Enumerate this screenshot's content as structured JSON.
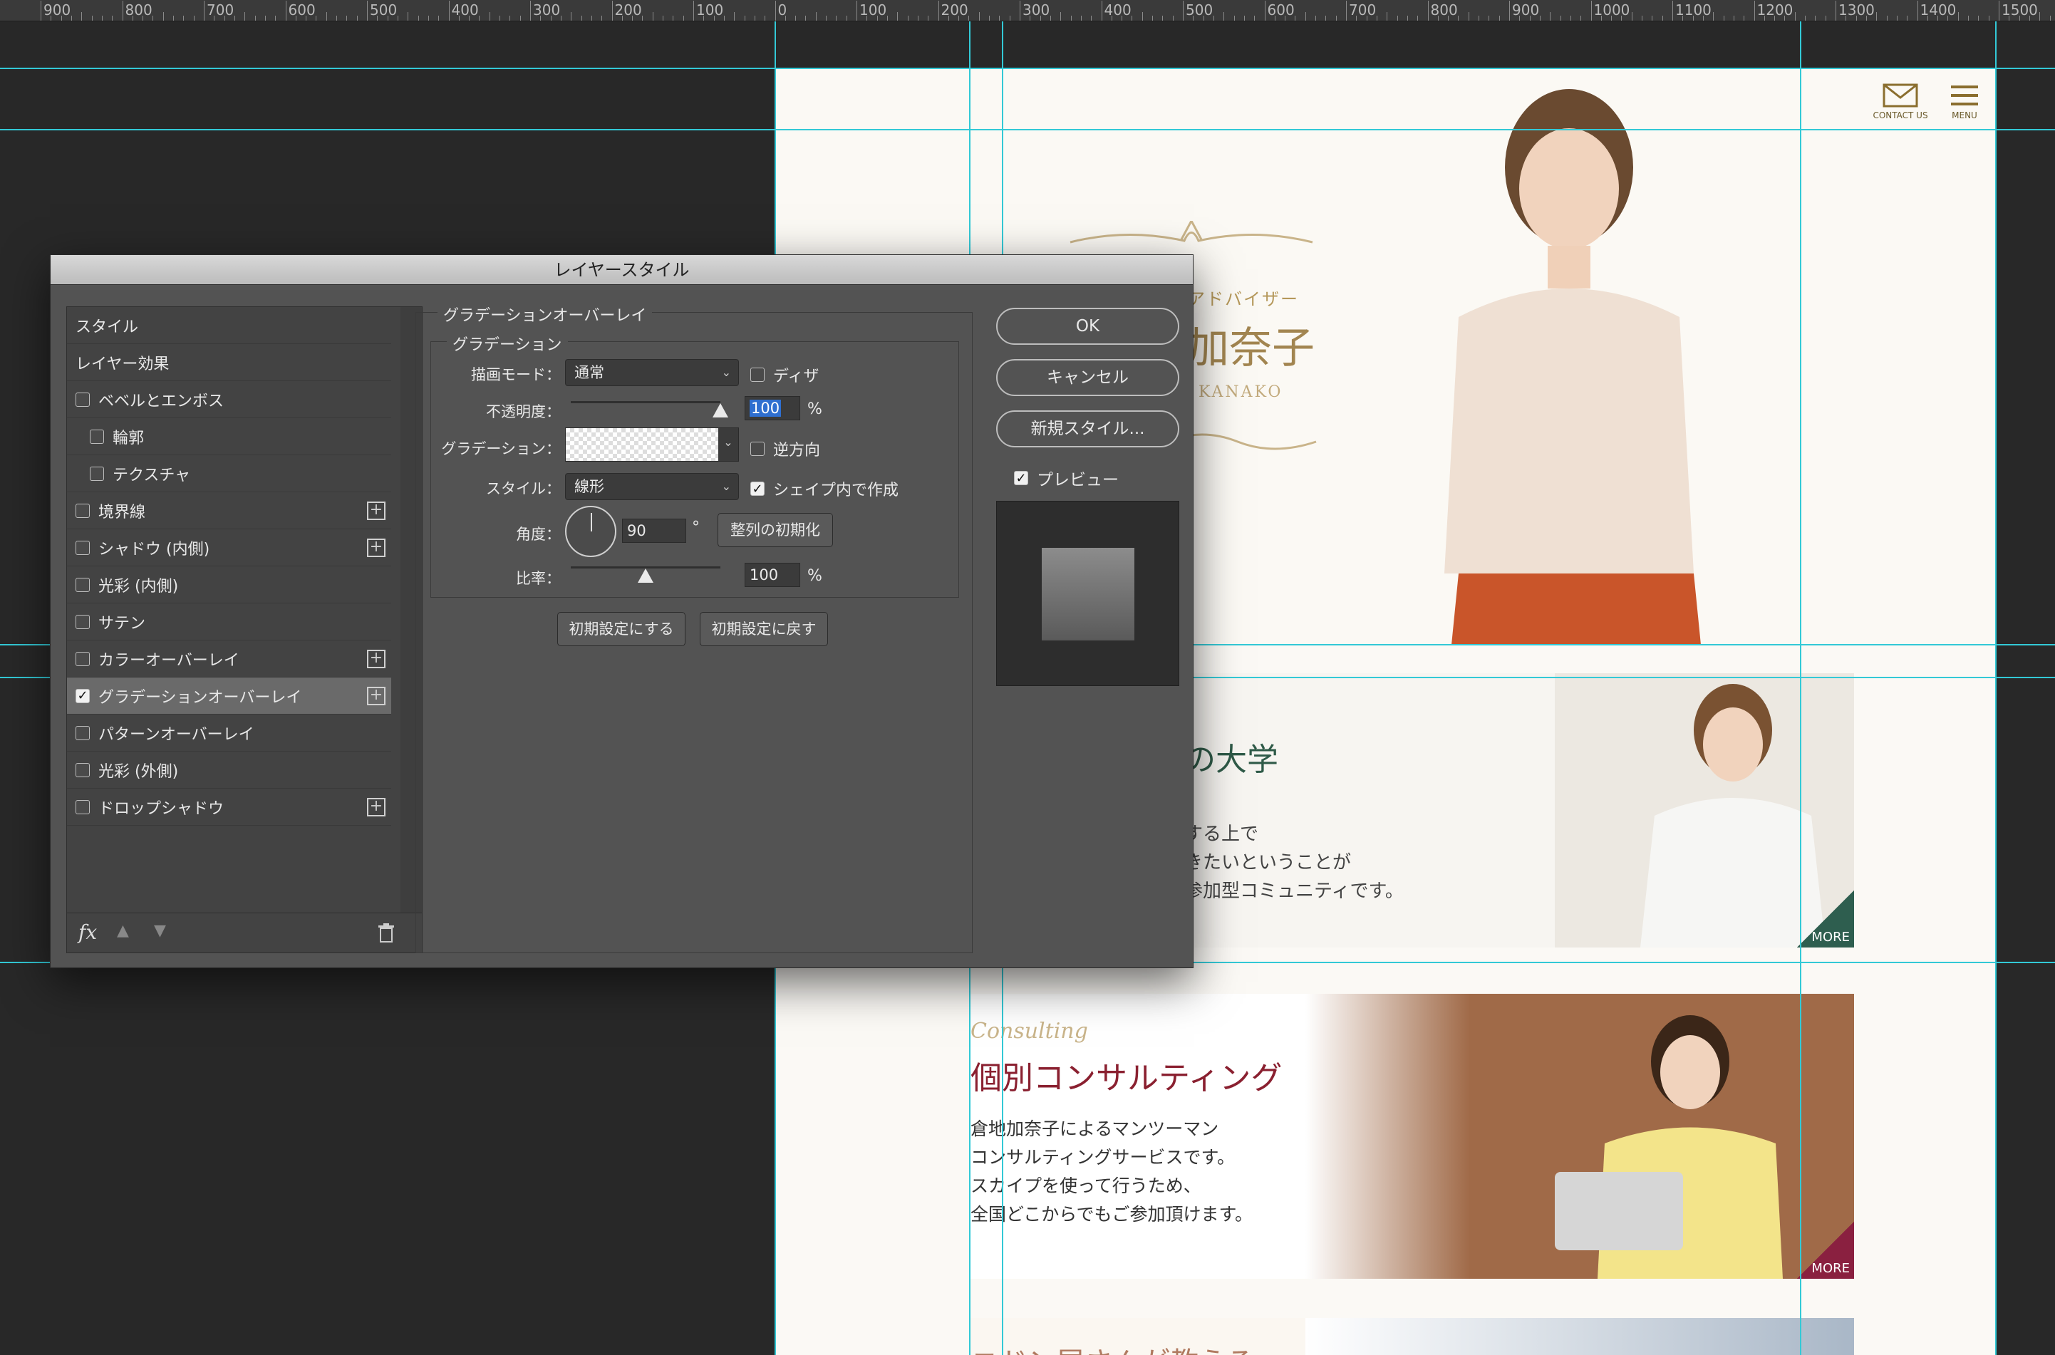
{
  "ruler": {
    "labels": [
      "900",
      "800",
      "700",
      "600",
      "500",
      "400",
      "300",
      "200",
      "100",
      "0",
      "100",
      "200",
      "300",
      "400",
      "500",
      "600",
      "700",
      "800",
      "900",
      "1000",
      "1100",
      "1200",
      "1300",
      "1400",
      "1500"
    ]
  },
  "page": {
    "header": {
      "contact_label": "CONTACT US",
      "menu_label": "MENU"
    },
    "hero": {
      "subtitle": "アドバイザー",
      "name": "加奈子",
      "name_en": "KANAKO"
    },
    "card2": {
      "title": "の大学",
      "lines": [
        "する上で",
        "きたいということが",
        "参加型コミュニティです。"
      ],
      "more": "MORE"
    },
    "card3": {
      "script": "Consulting",
      "title": "個別コンサルティング",
      "lines": [
        "倉地加奈子によるマンツーマン",
        "コンサルティングサービスです。",
        "スカイプを使って行うため、",
        "全国どこからでもご参加頂けます。"
      ],
      "more": "MORE"
    },
    "card4": {
      "title": "ニドン屋さんが教える"
    }
  },
  "dialog": {
    "title": "レイヤースタイル",
    "list": {
      "header_items": [
        "スタイル",
        "レイヤー効果"
      ],
      "items": [
        {
          "label": "ベベルとエンボス",
          "checked": false,
          "plus": false,
          "indent": false
        },
        {
          "label": "輪郭",
          "checked": false,
          "plus": false,
          "indent": true
        },
        {
          "label": "テクスチャ",
          "checked": false,
          "plus": false,
          "indent": true
        },
        {
          "label": "境界線",
          "checked": false,
          "plus": true,
          "indent": false
        },
        {
          "label": "シャドウ (内側)",
          "checked": false,
          "plus": true,
          "indent": false
        },
        {
          "label": "光彩 (内側)",
          "checked": false,
          "plus": false,
          "indent": false
        },
        {
          "label": "サテン",
          "checked": false,
          "plus": false,
          "indent": false
        },
        {
          "label": "カラーオーバーレイ",
          "checked": false,
          "plus": true,
          "indent": false
        },
        {
          "label": "グラデーションオーバーレイ",
          "checked": true,
          "plus": true,
          "indent": false,
          "active": true
        },
        {
          "label": "パターンオーバーレイ",
          "checked": false,
          "plus": false,
          "indent": false
        },
        {
          "label": "光彩 (外側)",
          "checked": false,
          "plus": false,
          "indent": false
        },
        {
          "label": "ドロップシャドウ",
          "checked": false,
          "plus": true,
          "indent": false
        }
      ],
      "fx_label": "fx"
    },
    "group_title": "グラデーションオーバーレイ",
    "sub_title": "グラデーション",
    "fields": {
      "blend_label": "描画モード：",
      "blend_value": "通常",
      "dither_label": "ディザ",
      "opacity_label": "不透明度：",
      "opacity_value": "100",
      "opacity_unit": "%",
      "opacity_fraction": 1.0,
      "gradient_label": "グラデーション：",
      "reverse_label": "逆方向",
      "style_label": "スタイル：",
      "style_value": "線形",
      "align_label": "シェイプ内で作成",
      "angle_label": "角度：",
      "angle_value": "90",
      "angle_unit": "°",
      "reset_align_label": "整列の初期化",
      "scale_label": "比率：",
      "scale_value": "100",
      "scale_unit": "%",
      "scale_fraction": 0.5
    },
    "buttons": {
      "make_default": "初期設定にする",
      "reset_default": "初期設定に戻す",
      "ok": "OK",
      "cancel": "キャンセル",
      "new_style": "新規スタイル...",
      "preview_label": "プレビュー"
    },
    "colors": {
      "guide": "#33c9d6",
      "accent": "#2f6fd0"
    }
  }
}
